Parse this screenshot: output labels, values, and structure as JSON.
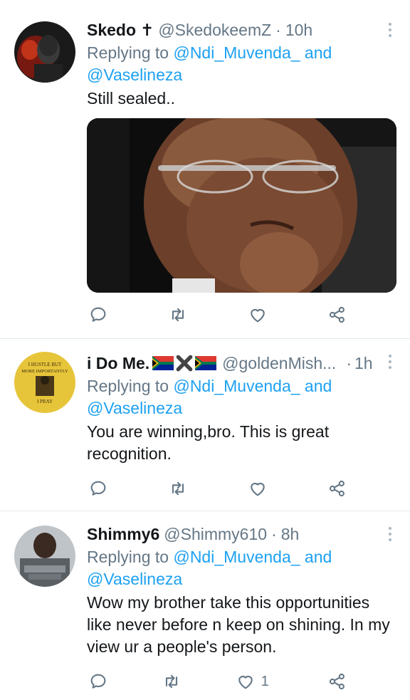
{
  "tweets": [
    {
      "name": "Skedo",
      "name_suffix": "✝",
      "handle": "@SkedokeemZ",
      "dot": "·",
      "time": "10h",
      "replying_prefix": "Replying to",
      "replying_user1": "@Ndi_Muvenda_",
      "replying_and": "and",
      "replying_user2": "@Vaselineza",
      "text": "Still sealed..",
      "has_media": true,
      "likes": ""
    },
    {
      "name": "i Do Me.",
      "handle": "@goldenMish...",
      "dot": "·",
      "time": "1h",
      "avatar_text_top": "I HUSTLE BUT",
      "avatar_text_mid": "MORE IMPORTANTLY",
      "avatar_text_bottom": "I PRAY",
      "replying_prefix": "Replying to",
      "replying_user1": "@Ndi_Muvenda_",
      "replying_and": "and",
      "replying_user2": "@Vaselineza",
      "text": "You are winning,bro. This is great recognition.",
      "likes": ""
    },
    {
      "name": "Shimmy6",
      "handle": "@Shimmy610",
      "dot": "·",
      "time": "8h",
      "replying_prefix": "Replying to",
      "replying_user1": "@Ndi_Muvenda_",
      "replying_and": "and",
      "replying_user2": "@Vaselineza",
      "text": "Wow my brother take this opportunities like never before n keep on shining. In my view ur a people's person.",
      "likes": "1"
    }
  ],
  "icons": {
    "reply": "reply-icon",
    "retweet": "retweet-icon",
    "like": "heart-icon",
    "share": "share-icon",
    "more": "more-icon"
  },
  "colors": {
    "link": "#1da1f2",
    "secondary": "#657786",
    "icon": "#657786",
    "divider": "#e1e8ed"
  }
}
